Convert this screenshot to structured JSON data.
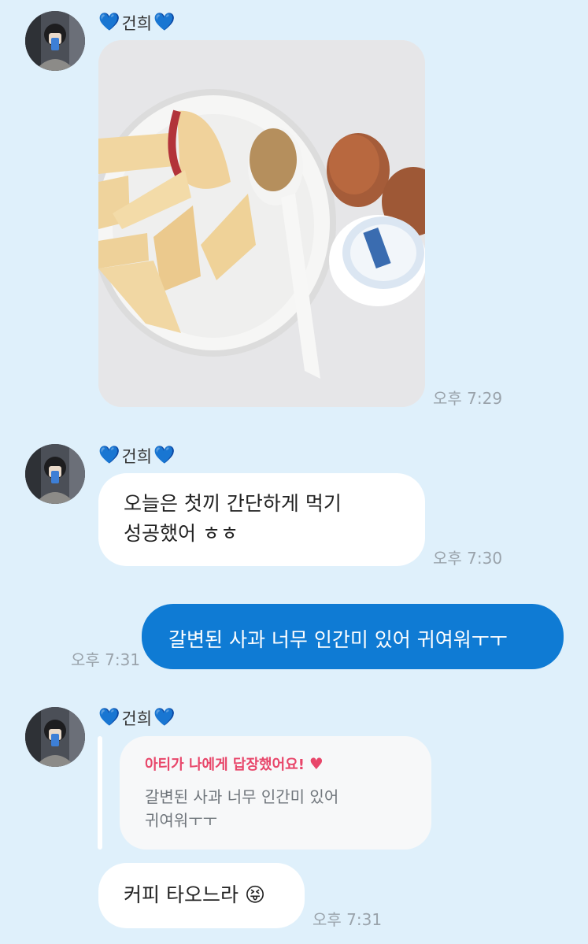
{
  "messages": [
    {
      "sender": "건희",
      "type": "photo",
      "photo_description_icon": "meal-photo",
      "time": "오후 7:29"
    },
    {
      "sender": "건희",
      "type": "text",
      "lines": [
        "오늘은 첫끼 간단하게 먹기",
        "성공했어 ㅎㅎ"
      ],
      "time": "오후 7:30"
    },
    {
      "type": "outgoing",
      "text": "갈변된 사과 너무 인간미 있어 귀여워ㅜㅜ",
      "time": "오후 7:31"
    },
    {
      "sender": "건희",
      "type": "reply",
      "reply_title": "아티가 나에게 답장했어요!",
      "reply_heart": "♥",
      "quote_lines": [
        "갈변된 사과 너무 인간미 있어",
        "귀여워ㅜㅜ"
      ],
      "text": "커피 타오느라",
      "emoji": "😝",
      "time": "오후 7:31"
    }
  ],
  "heart_icon": "💙",
  "colors": {
    "background": "#dff0fb",
    "outgoing_bubble": "#0f7bd4",
    "incoming_bubble": "#ffffff",
    "reply_accent": "#e8466a",
    "sender_heart": "#2f8ff0"
  }
}
